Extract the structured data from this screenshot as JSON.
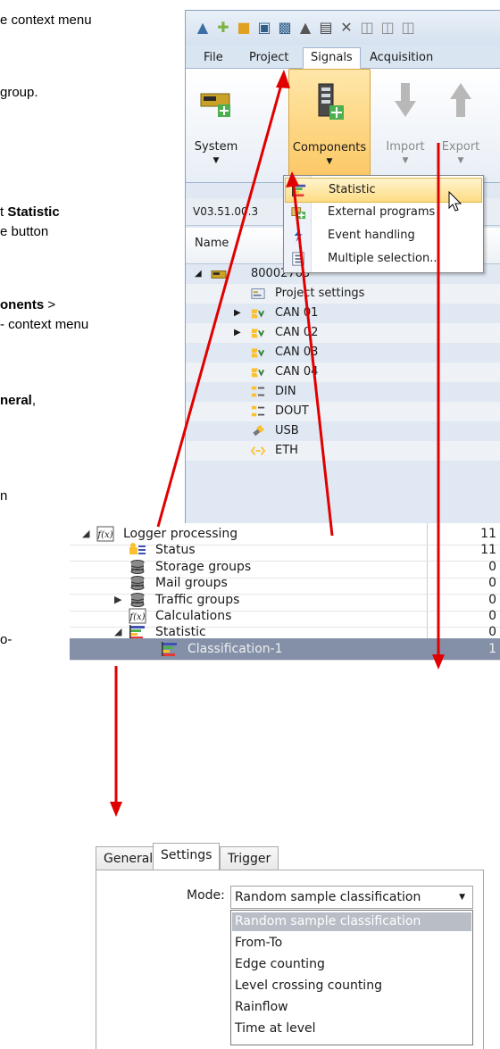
{
  "doc_text": {
    "line1": "e context menu",
    "line2": "group.",
    "line3_pre": "t ",
    "line3_bold": "Statistic",
    "line4": "e button",
    "line5_bold": "onents",
    "line5_post": " >",
    "line6": "- context menu",
    "line7_bold": "neral",
    "line7_post": ",",
    "line8": "n",
    "line9": "o-"
  },
  "qat_icons": [
    "app-menu-icon",
    "new-icon",
    "open-icon",
    "save-icon",
    "save-as-icon",
    "auto-icon",
    "print-icon",
    "cut-icon",
    "copy-icon",
    "paste-icon",
    "paste-special-icon"
  ],
  "menu_tabs": [
    "File",
    "Project",
    "Signals",
    "Acquisition"
  ],
  "active_menu_tab": "Signals",
  "ribbon": {
    "system_label": "System",
    "components_label": "Components",
    "import_label": "Import",
    "export_label": "Export"
  },
  "context_menu": [
    {
      "label": "Statistic",
      "icon": "statistic-icon",
      "selected": true
    },
    {
      "label": "External programs",
      "icon": "external-programs-icon",
      "selected": false
    },
    {
      "label": "Event handling",
      "icon": "event-handling-icon",
      "selected": false
    },
    {
      "label": "Multiple selection...",
      "icon": "multiple-selection-icon",
      "selected": false
    }
  ],
  "version_text": "V03.51.00.3",
  "name_header": "Name",
  "tree_top": [
    {
      "label": "80002763",
      "icon": "device-icon",
      "expander": "open",
      "level": 0
    },
    {
      "label": "Project settings",
      "icon": "project-settings-icon",
      "expander": "",
      "level": 1
    },
    {
      "label": "CAN 01",
      "icon": "can-icon",
      "expander": "closed",
      "level": 1
    },
    {
      "label": "CAN 02",
      "icon": "can-icon",
      "expander": "closed",
      "level": 1
    },
    {
      "label": "CAN 03",
      "icon": "can-icon",
      "expander": "",
      "level": 1
    },
    {
      "label": "CAN 04",
      "icon": "can-icon",
      "expander": "",
      "level": 1
    },
    {
      "label": "DIN",
      "icon": "din-icon",
      "expander": "",
      "level": 1
    },
    {
      "label": "DOUT",
      "icon": "dout-icon",
      "expander": "",
      "level": 1
    },
    {
      "label": "USB",
      "icon": "usb-icon",
      "expander": "",
      "level": 1
    },
    {
      "label": "ETH",
      "icon": "eth-icon",
      "expander": "",
      "level": 1
    }
  ],
  "tree_mid": [
    {
      "label": "Logger processing",
      "icon": "function-icon",
      "expander": "open",
      "level": 0,
      "count": "11"
    },
    {
      "label": "Status",
      "icon": "status-icon",
      "expander": "",
      "level": 1,
      "count": "11"
    },
    {
      "label": "Storage groups",
      "icon": "storage-groups-icon",
      "expander": "",
      "level": 1,
      "count": "0"
    },
    {
      "label": "Mail groups",
      "icon": "mail-groups-icon",
      "expander": "",
      "level": 1,
      "count": "0"
    },
    {
      "label": "Traffic groups",
      "icon": "traffic-groups-icon",
      "expander": "closed",
      "level": 1,
      "count": "0"
    },
    {
      "label": "Calculations",
      "icon": "calculations-icon",
      "expander": "",
      "level": 1,
      "count": "0"
    },
    {
      "label": "Statistic",
      "icon": "statistic-icon",
      "expander": "open",
      "level": 1,
      "count": "0"
    },
    {
      "label": "Classification-1",
      "icon": "statistic-icon",
      "expander": "",
      "level": 2,
      "count": "1"
    }
  ],
  "settings_tabs": [
    "General",
    "Settings",
    "Trigger"
  ],
  "active_settings_tab": "Settings",
  "mode_label": "Mode:",
  "mode_value": "Random sample classification",
  "mode_options": [
    "Random sample classification",
    "From-To",
    "Edge counting",
    "Level crossing counting",
    "Rainflow",
    "Time at level"
  ],
  "colors": {
    "accent": "#fcc865",
    "arrow": "#e00000",
    "selection": "#8390a8"
  }
}
